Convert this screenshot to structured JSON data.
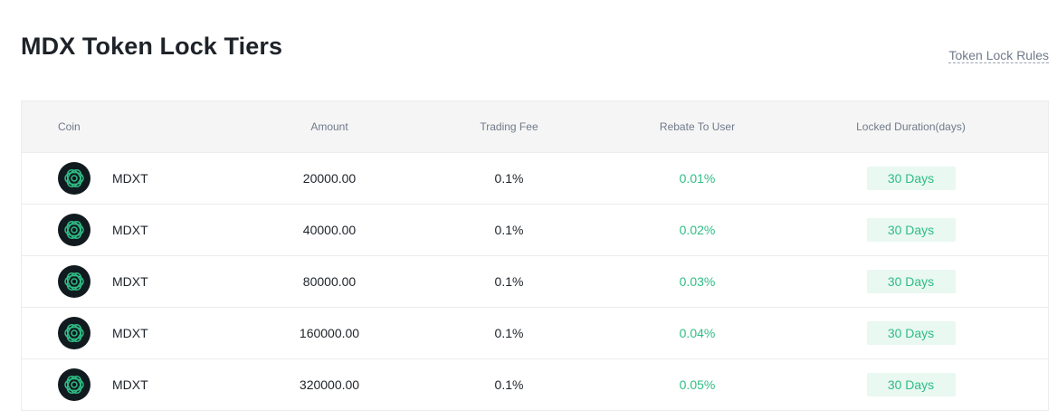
{
  "page": {
    "title": "MDX Token Lock Tiers",
    "rules_link": "Token Lock Rules"
  },
  "table": {
    "headers": {
      "coin": "Coin",
      "amount": "Amount",
      "fee": "Trading Fee",
      "rebate": "Rebate To User",
      "duration": "Locked Duration(days)"
    },
    "rows": [
      {
        "coin": "MDXT",
        "amount": "20000.00",
        "fee": "0.1%",
        "rebate": "0.01%",
        "duration": "30 Days"
      },
      {
        "coin": "MDXT",
        "amount": "40000.00",
        "fee": "0.1%",
        "rebate": "0.02%",
        "duration": "30 Days"
      },
      {
        "coin": "MDXT",
        "amount": "80000.00",
        "fee": "0.1%",
        "rebate": "0.03%",
        "duration": "30 Days"
      },
      {
        "coin": "MDXT",
        "amount": "160000.00",
        "fee": "0.1%",
        "rebate": "0.04%",
        "duration": "30 Days"
      },
      {
        "coin": "MDXT",
        "amount": "320000.00",
        "fee": "0.1%",
        "rebate": "0.05%",
        "duration": "30 Days"
      }
    ]
  },
  "colors": {
    "accent_green": "#2ebd85",
    "badge_bg": "#e9f8f1",
    "text_primary": "#1e2329",
    "text_secondary": "#707a8a"
  },
  "icons": {
    "coin_logo": "mdx-coin-icon"
  }
}
